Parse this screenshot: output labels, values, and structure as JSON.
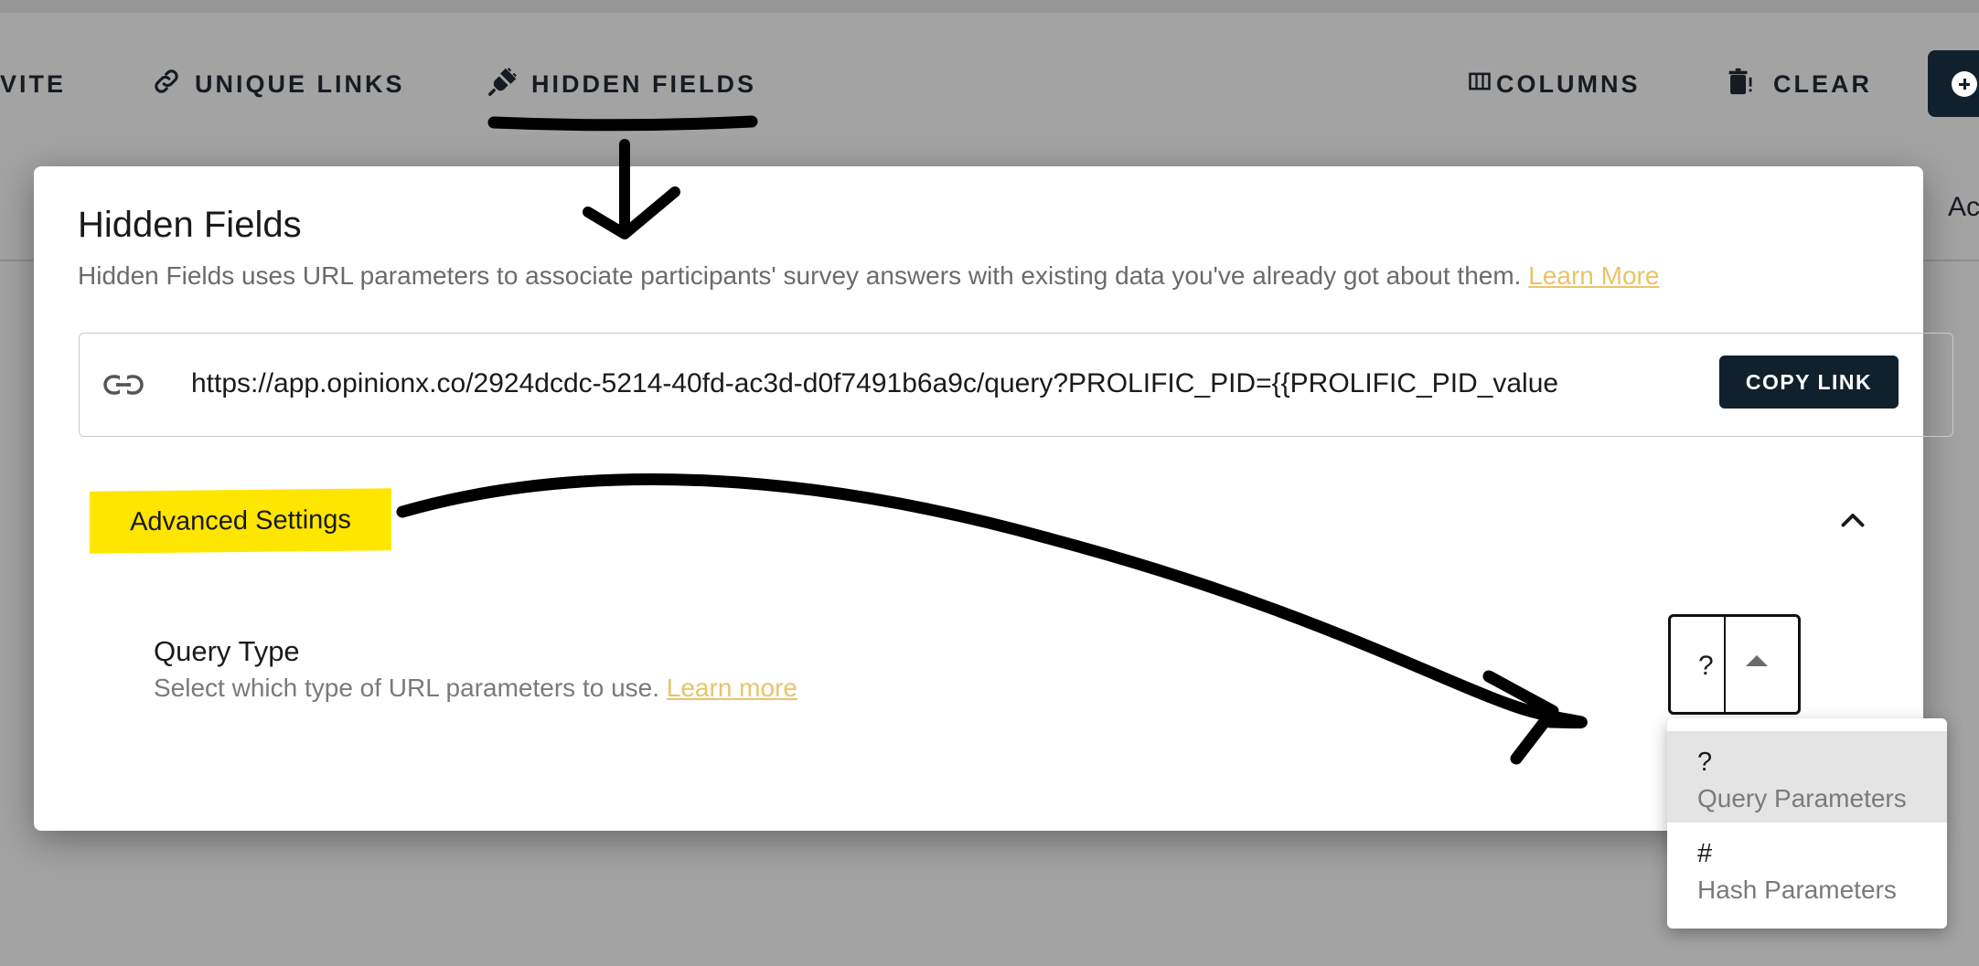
{
  "toolbar": {
    "invite_label": "VITE",
    "unique_links_label": "UNIQUE LINKS",
    "hidden_fields_label": "HIDDEN FIELDS",
    "columns_label": "COLUMNS",
    "clear_label": "CLEAR",
    "actions_partial": "Ac"
  },
  "modal": {
    "title": "Hidden Fields",
    "description": "Hidden Fields uses URL parameters to associate participants' survey answers with existing data you've already got about them.",
    "learn_more_label": "Learn More",
    "link_url": "https://app.opinionx.co/2924dcdc-5214-40fd-ac3d-d0f7491b6a9c/query?PROLIFIC_PID={{PROLIFIC_PID_value",
    "copy_link_label": "COPY LINK",
    "advanced_settings_label": "Advanced Settings",
    "query_type": {
      "title": "Query Type",
      "description": "Select which type of URL parameters to use.",
      "learn_more_label": "Learn more",
      "selected_value": "?",
      "options": [
        {
          "symbol": "?",
          "label": "Query Parameters",
          "selected": true
        },
        {
          "symbol": "#",
          "label": "Hash Parameters",
          "selected": false
        }
      ]
    }
  },
  "colors": {
    "accent_dark": "#11202d",
    "link_yellow": "#e8c46a",
    "highlight": "#ffe600"
  },
  "icons": {
    "unique_links": "link-icon",
    "hidden_fields": "plug-icon",
    "columns": "columns-icon",
    "clear": "trash-icon",
    "add": "plus-circle-icon",
    "url_field": "link-icon",
    "advanced_toggle": "chevron-up-icon",
    "select_caret": "caret-up-icon"
  }
}
